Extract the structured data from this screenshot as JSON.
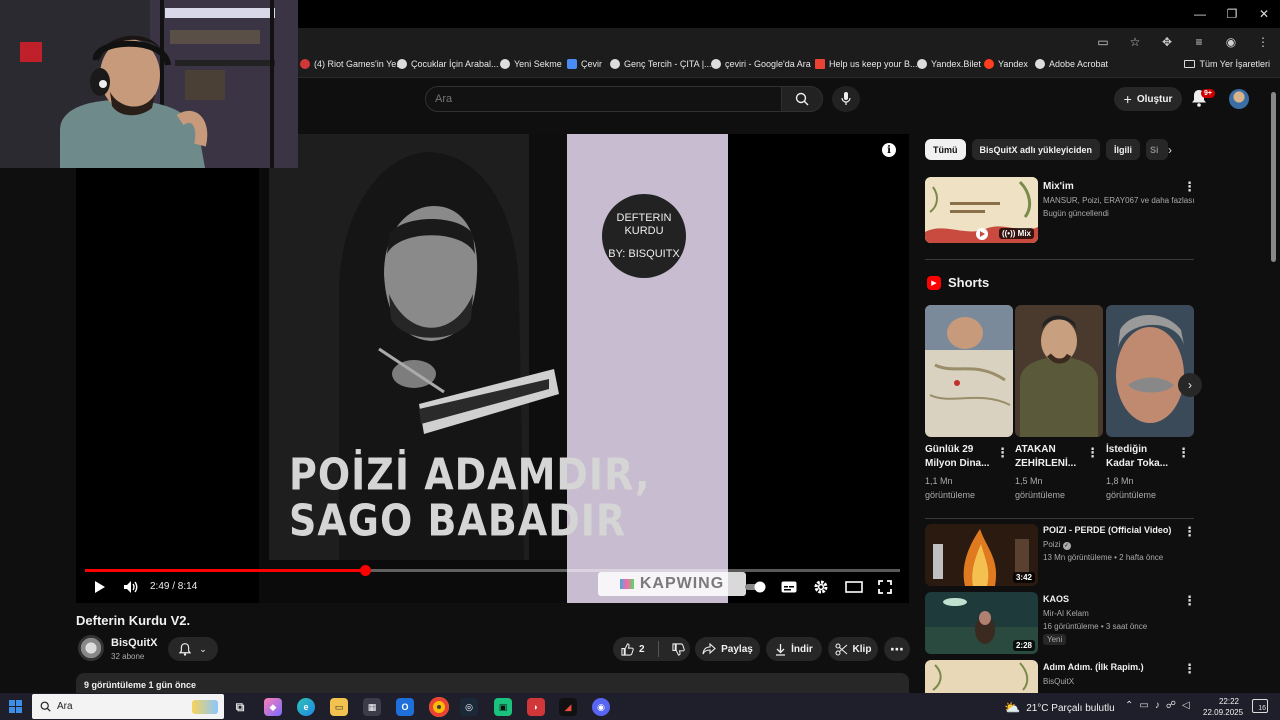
{
  "window": {
    "controls": [
      "—",
      "❐",
      "✕"
    ]
  },
  "bookmarks": [
    {
      "label": "(4) Riot Games'in Ye...",
      "color": "#d13639"
    },
    {
      "label": "Çocuklar İçin Arabal...",
      "color": "#ffffff"
    },
    {
      "label": "Yeni Sekme",
      "color": "#ffffff"
    },
    {
      "label": "Çevir",
      "color": "#4b8df8"
    },
    {
      "label": "Genç Tercih - ÇITA |...",
      "color": "#ffffff"
    },
    {
      "label": "çeviri - Google'da Ara",
      "color": "#ffffff"
    },
    {
      "label": "Help us keep your B...",
      "color": "#ea4335"
    },
    {
      "label": "Yandex.Bilet",
      "color": "#ffffff"
    },
    {
      "label": "Yandex",
      "color": "#fc3f1d"
    },
    {
      "label": "Adobe Acrobat",
      "color": "#ffffff"
    }
  ],
  "all_bookmarks": "Tüm Yer İşaretleri",
  "header": {
    "search_placeholder": "Ara",
    "create_label": "Oluştur",
    "notif_count": "9+"
  },
  "player": {
    "circle_line1": "DEFTERIN KURDU",
    "circle_line2": "BY: BISQUITX",
    "overlay_line1": "POİZİ ADAMDIR,",
    "overlay_line2": "SAGO BABADIR",
    "watermark": "KAPWING",
    "time": "2:49 / 8:14",
    "progress": 0.343
  },
  "video": {
    "title": "Defterin Kurdu V2.",
    "channel": "BisQuitX",
    "subs": "32 abone",
    "likes": "2",
    "share": "Paylaş",
    "download": "İndir",
    "clip": "Klip",
    "views_date": "9 görüntüleme  1 gün önce"
  },
  "chips": [
    {
      "label": "Tümü",
      "active": true
    },
    {
      "label": "BisQuitX adlı yükleyiciden",
      "active": false
    },
    {
      "label": "İlgili",
      "active": false
    },
    {
      "label": "Si",
      "active": false
    }
  ],
  "mix": {
    "title": "Mix'im",
    "sub1": "MANSUR, Poizi, ERAY067 ve daha fazlası",
    "sub2": "Bugün güncellendi",
    "badge": "Mix"
  },
  "shorts": {
    "label": "Shorts",
    "items": [
      {
        "title": "Günlük 29 Milyon Dina...",
        "views": "1,1 Mn görüntüleme"
      },
      {
        "title": "ATAKAN ZEHİRLENİ...",
        "views": "1,5 Mn görüntüleme"
      },
      {
        "title": "İstediğin Kadar Toka...",
        "views": "1,8 Mn görüntüleme"
      }
    ]
  },
  "recommended": [
    {
      "title": "POIZI - PERDE (Official Video)",
      "channel": "Poizi",
      "meta": "13 Mn görüntüleme • 2 hafta önce",
      "duration": "3:42",
      "badge": ""
    },
    {
      "title": "KAOS",
      "channel": "Mir-Al Kelam",
      "meta": "16 görüntüleme • 3 saat önce",
      "duration": "2:28",
      "badge": "Yeni"
    },
    {
      "title": "Adım Adım. (İlk Rapim.)",
      "channel": "BisQuitX",
      "meta": "",
      "duration": "",
      "badge": ""
    }
  ],
  "taskbar": {
    "search": "Ara",
    "weather": "21°C  Parçalı bulutlu",
    "time": "22:22",
    "date": "22.09.2025",
    "notif": "16"
  }
}
